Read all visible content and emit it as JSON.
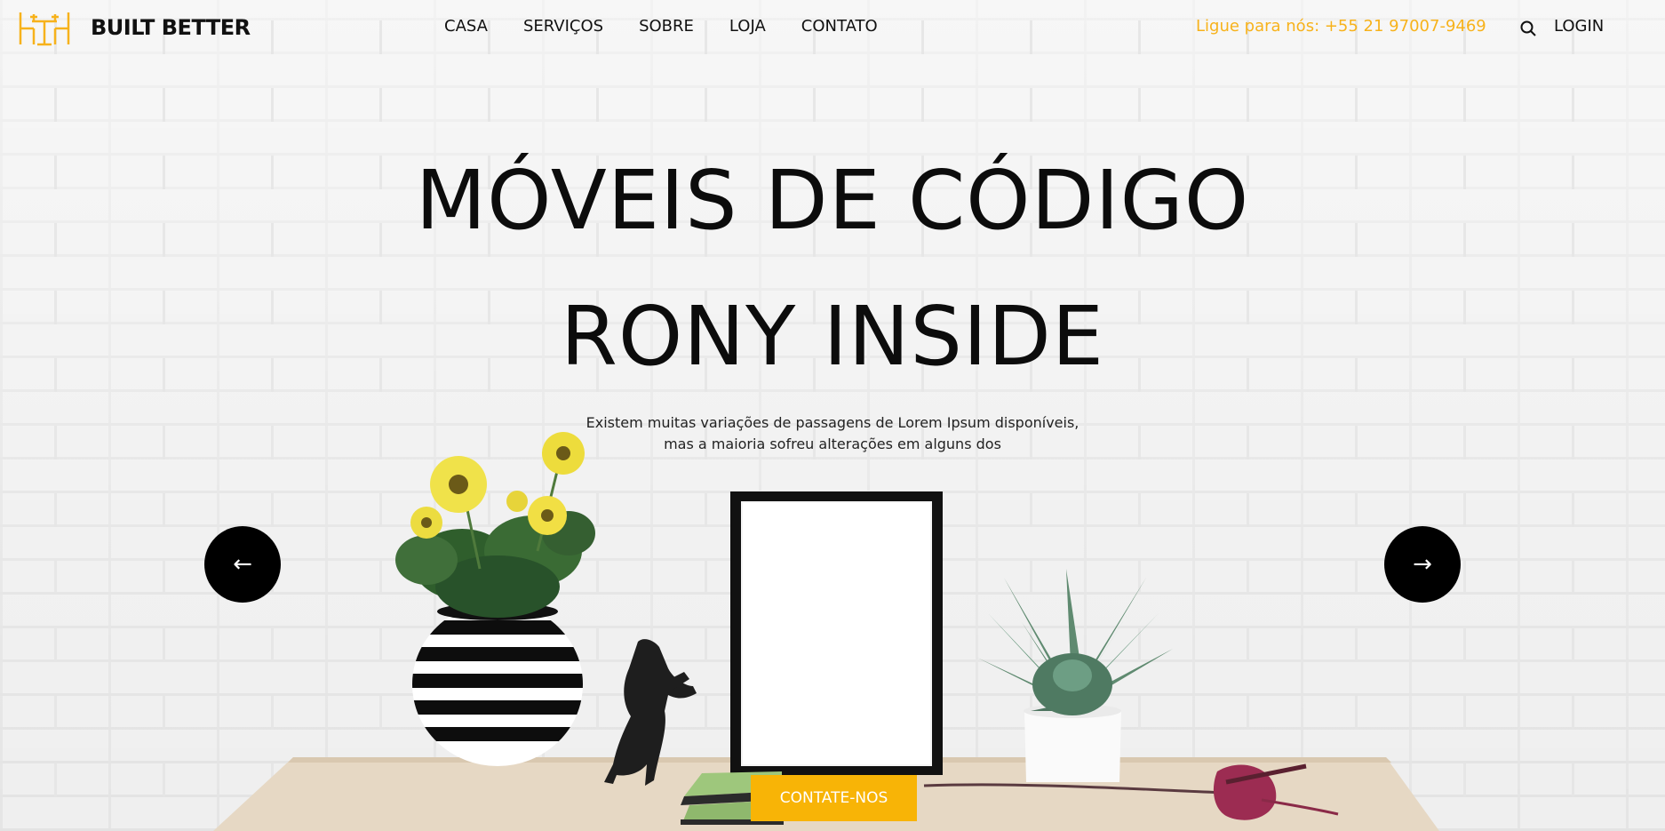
{
  "brand": {
    "name": "BUILT BETTER",
    "logo_icon": "furniture-logo-icon",
    "accent": "#f7b21b"
  },
  "nav": {
    "items": [
      {
        "label": "CASA"
      },
      {
        "label": "SERVIÇOS"
      },
      {
        "label": "SOBRE"
      },
      {
        "label": "LOJA"
      },
      {
        "label": "CONTATO"
      }
    ]
  },
  "header": {
    "phone": "Ligue para nós: +55 21 97007-9469",
    "search_icon": "search-icon",
    "login": "LOGIN"
  },
  "hero": {
    "title_line1": "MÓVEIS DE CÓDIGO",
    "title_line2": "RONY INSIDE",
    "subtitle_line1": "Existem muitas variações de passagens de Lorem Ipsum disponíveis,",
    "subtitle_line2": "mas a maioria sofreu alterações em alguns dos",
    "prev_arrow": "←",
    "next_arrow": "→",
    "cta_label": "CONTATE-NOS",
    "cta_color": "#f8b406"
  }
}
